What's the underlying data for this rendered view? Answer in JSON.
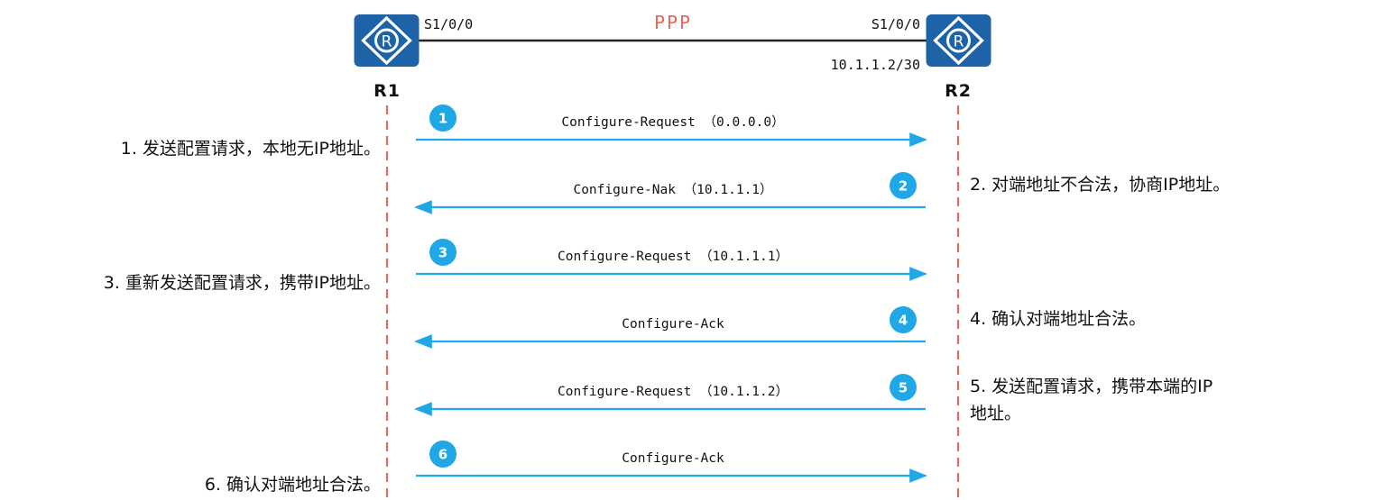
{
  "link": {
    "protocol": "PPP"
  },
  "routers": {
    "r1": {
      "name": "R1",
      "interface": "S1/0/0",
      "icon": "router-icon",
      "color": "#1e63a8"
    },
    "r2": {
      "name": "R2",
      "interface": "S1/0/0",
      "address": "10.1.1.2/30",
      "icon": "router-icon",
      "color": "#1e63a8"
    }
  },
  "colors": {
    "arrow": "#1fa7e6",
    "badge": "#1fa7e6",
    "lifeline": "#e06a5c",
    "title": "#e8665a"
  },
  "steps": [
    {
      "number": "1",
      "message": "Configure-Request （0.0.0.0）",
      "direction": "R1->R2",
      "note": [
        "1. 发送配置请求，本地无IP地址。"
      ],
      "note_side": "left"
    },
    {
      "number": "2",
      "message": "Configure-Nak （10.1.1.1）",
      "direction": "R2->R1",
      "note": [
        "2. 对端地址不合法，协商IP地址。"
      ],
      "note_side": "right"
    },
    {
      "number": "3",
      "message": "Configure-Request （10.1.1.1）",
      "direction": "R1->R2",
      "note": [
        "3. 重新发送配置请求，携带IP地址。"
      ],
      "note_side": "left"
    },
    {
      "number": "4",
      "message": "Configure-Ack",
      "direction": "R2->R1",
      "note": [
        "4. 确认对端地址合法。"
      ],
      "note_side": "right"
    },
    {
      "number": "5",
      "message": "Configure-Request （10.1.1.2）",
      "direction": "R2->R1",
      "note": [
        "5. 发送配置请求，携带本端的IP",
        "地址。"
      ],
      "note_side": "right"
    },
    {
      "number": "6",
      "message": "Configure-Ack",
      "direction": "R1->R2",
      "note": [
        "6. 确认对端地址合法。"
      ],
      "note_side": "left"
    }
  ]
}
